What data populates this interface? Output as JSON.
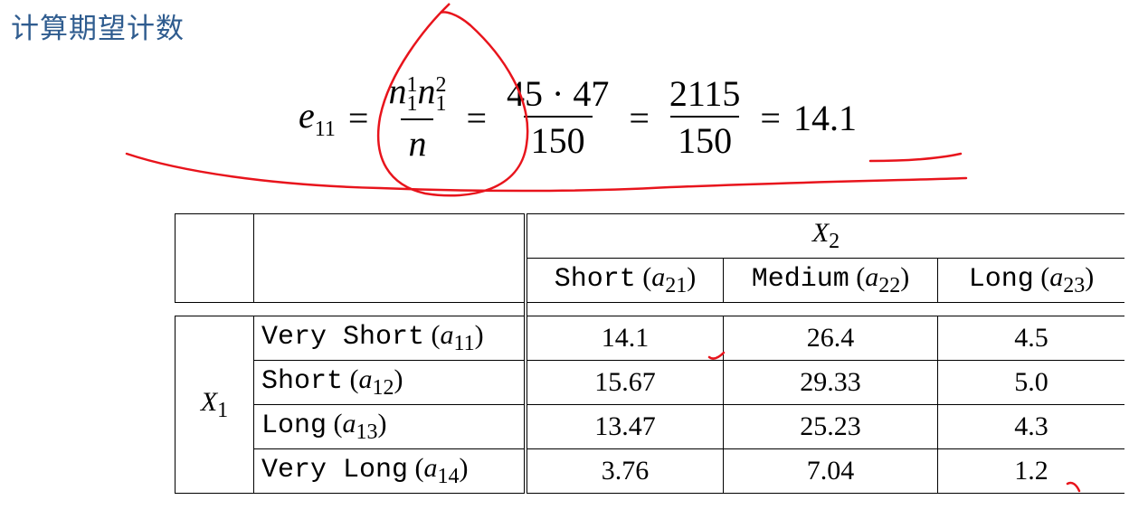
{
  "title": "计算期望计数",
  "formula": {
    "lhs": "e",
    "lhs_sub": "11",
    "eq": "=",
    "f1_num": "n",
    "f1_sup1": "1",
    "f1_sub1": "1",
    "f1_sup2": "2",
    "f1_sub2": "1",
    "f1_den": "n",
    "f2_num": "45 · 47",
    "f2_den": "150",
    "f3_num": "2115",
    "f3_den": "150",
    "result": "14.1"
  },
  "table": {
    "col_group_var": "X",
    "col_group_sub": "2",
    "row_group_var": "X",
    "row_group_sub": "1",
    "columns": [
      {
        "name": "Short",
        "var": "a",
        "sub": "21"
      },
      {
        "name": "Medium",
        "var": "a",
        "sub": "22"
      },
      {
        "name": "Long",
        "var": "a",
        "sub": "23"
      }
    ],
    "rows": [
      {
        "name": "Very Short",
        "var": "a",
        "sub": "11",
        "values": [
          "14.1",
          "26.4",
          "4.5"
        ]
      },
      {
        "name": "Short",
        "var": "a",
        "sub": "12",
        "values": [
          "15.67",
          "29.33",
          "5.0"
        ]
      },
      {
        "name": "Long",
        "var": "a",
        "sub": "13",
        "values": [
          "13.47",
          "25.23",
          "4.3"
        ]
      },
      {
        "name": "Very Long",
        "var": "a",
        "sub": "14",
        "values": [
          "3.76",
          "7.04",
          "1.2"
        ]
      }
    ]
  },
  "annotation_color": "#e8141c"
}
